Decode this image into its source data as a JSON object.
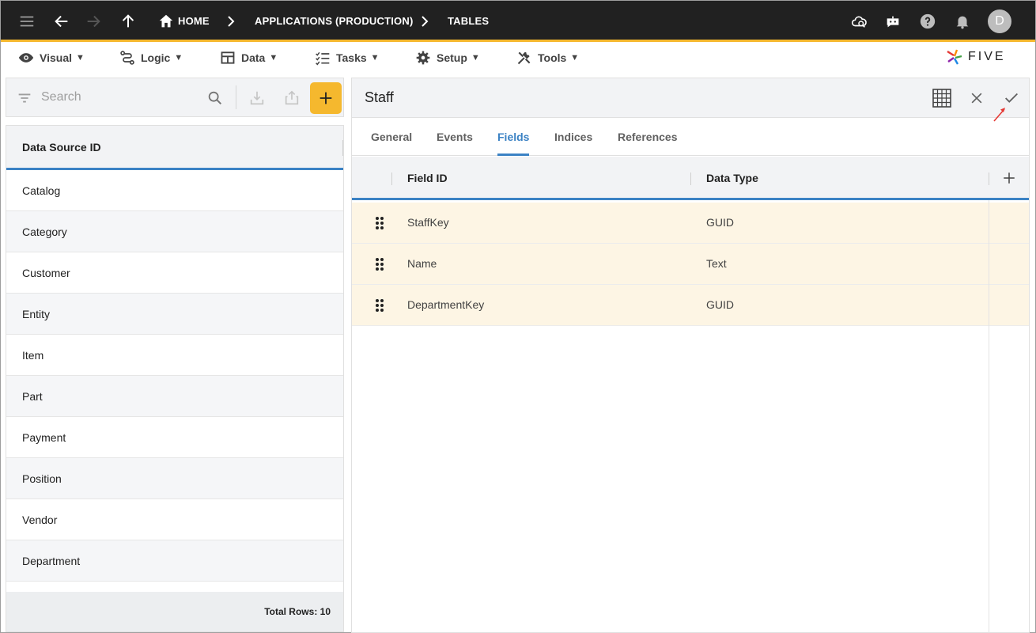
{
  "topbar": {
    "breadcrumbs": [
      "HOME",
      "APPLICATIONS (PRODUCTION)",
      "TABLES"
    ],
    "avatar_initial": "D",
    "accent_color": "#f5b82e"
  },
  "menubar": {
    "items": [
      {
        "label": "Visual",
        "icon": "eye-icon"
      },
      {
        "label": "Logic",
        "icon": "logic-icon"
      },
      {
        "label": "Data",
        "icon": "table-icon"
      },
      {
        "label": "Tasks",
        "icon": "tasks-icon"
      },
      {
        "label": "Setup",
        "icon": "gear-icon"
      },
      {
        "label": "Tools",
        "icon": "tools-icon"
      }
    ],
    "caret": "▼",
    "logo_text": "FIVE"
  },
  "left": {
    "search_placeholder": "Search",
    "column_header": "Data Source ID",
    "rows": [
      "Catalog",
      "Category",
      "Customer",
      "Entity",
      "Item",
      "Part",
      "Payment",
      "Position",
      "Vendor",
      "Department"
    ],
    "footer": "Total Rows: 10"
  },
  "right": {
    "title": "Staff",
    "tabs": [
      "General",
      "Events",
      "Fields",
      "Indices",
      "References"
    ],
    "active_tab": "Fields",
    "columns": [
      "Field ID",
      "Data Type"
    ],
    "rows": [
      {
        "field_id": "StaffKey",
        "data_type": "GUID"
      },
      {
        "field_id": "Name",
        "data_type": "Text"
      },
      {
        "field_id": "DepartmentKey",
        "data_type": "GUID"
      }
    ],
    "row_highlight_color": "#fdf5e4",
    "tab_accent_color": "#3b82c4"
  }
}
